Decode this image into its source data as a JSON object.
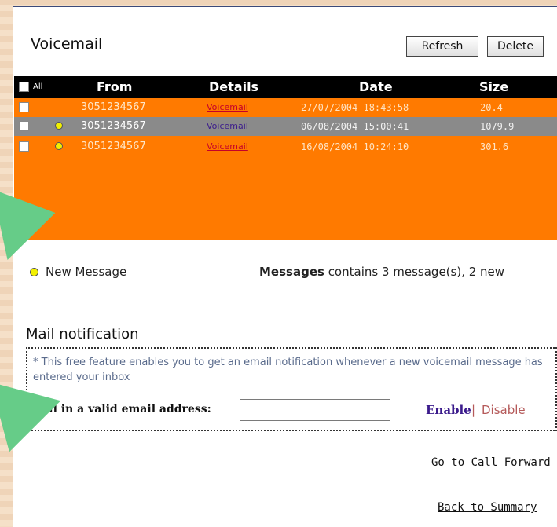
{
  "page": {
    "title": "Voicemail",
    "buttons": {
      "refresh": "Refresh",
      "delete": "Delete"
    }
  },
  "messages_table": {
    "headers": {
      "all": "All",
      "from": "From",
      "details": "Details",
      "date": "Date",
      "size": "Size"
    },
    "rows": [
      {
        "from": "3051234567",
        "details": "Voicemail",
        "date": "27/07/2004 18:43:58",
        "size": "20.4",
        "new": false,
        "selected": false
      },
      {
        "from": "3051234567",
        "details": "Voicemail",
        "date": "06/08/2004 15:00:41",
        "size": "1079.9",
        "new": true,
        "selected": true
      },
      {
        "from": "3051234567",
        "details": "Voicemail",
        "date": "16/08/2004 10:24:10",
        "size": "301.6",
        "new": true,
        "selected": false
      }
    ]
  },
  "legend": {
    "new_message": "New Message"
  },
  "summary": {
    "bold": "Messages",
    "text": " contains 3 message(s), 2 new"
  },
  "mail_notification": {
    "title": "Mail notification",
    "description": "* This free feature enables you to get an email notification whenever a new voicemail message has entered your inbox",
    "email_label": "Fill in a valid email address:",
    "email_value": "",
    "enable": "Enable",
    "separator": "|",
    "disable": "Disable"
  },
  "links": {
    "call_forward": "Go to Call Forward",
    "summary": "Back to Summary"
  },
  "colors": {
    "table_bg": "#ff7a00",
    "header_bg": "#000000",
    "selected_row": "#8a8a8a",
    "new_dot": "#f2f000",
    "arrow": "#66cc88"
  }
}
